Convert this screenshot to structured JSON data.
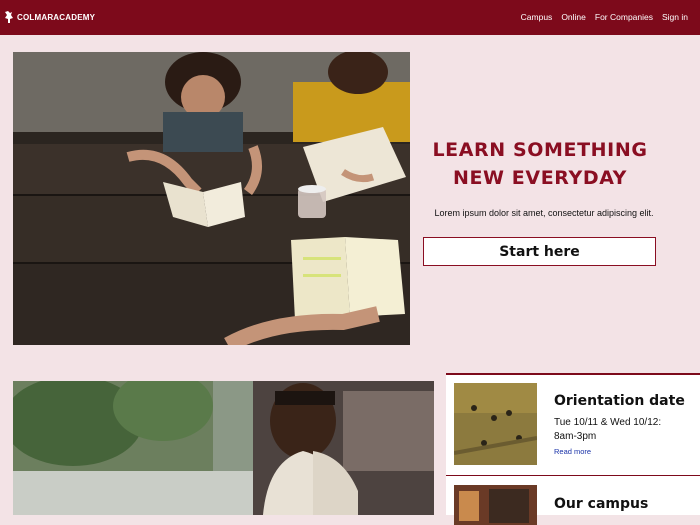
{
  "brand": {
    "name": "COLMARACADEMY",
    "logo_icon": "colmar-logo-icon"
  },
  "nav": {
    "items": [
      "Campus",
      "Online",
      "For Companies",
      "Sign in"
    ]
  },
  "hero": {
    "title_line1": "LEARN SOMETHING",
    "title_line2": "NEW EVERYDAY",
    "subtitle": "Lorem ipsum dolor sit amet, consectetur adipiscing elit.",
    "cta_label": "Start here"
  },
  "cards": [
    {
      "title": "Orientation date",
      "text_line1": "Tue 10/11 & Wed 10/12:",
      "text_line2": "8am-3pm",
      "link": "Read more"
    },
    {
      "title": "Our campus"
    }
  ],
  "colors": {
    "brand": "#7d0a1b",
    "accent": "#8a0e22",
    "background": "#f3e3e6",
    "link": "#1a33a8"
  }
}
